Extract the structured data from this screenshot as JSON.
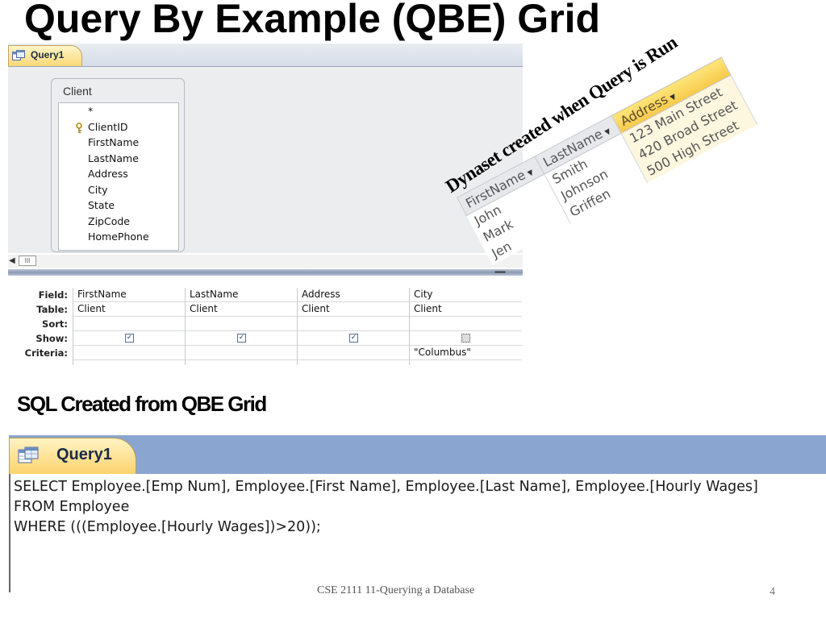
{
  "slide": {
    "title": "Query By Example (QBE) Grid",
    "sql_heading": "SQL Created from QBE Grid",
    "footer": "CSE 2111 11-Querying a Database",
    "number": "4"
  },
  "qbe": {
    "tab_label": "Query1",
    "table": {
      "name": "Client",
      "fields": [
        "*",
        "ClientID",
        "FirstName",
        "LastName",
        "Address",
        "City",
        "State",
        "ZipCode",
        "HomePhone"
      ]
    },
    "grid": {
      "row_headers": [
        "Field:",
        "Table:",
        "Sort:",
        "Show:",
        "Criteria:"
      ],
      "columns": [
        {
          "field": "FirstName",
          "table": "Client",
          "sort": "",
          "show": true,
          "criteria": ""
        },
        {
          "field": "LastName",
          "table": "Client",
          "sort": "",
          "show": true,
          "criteria": ""
        },
        {
          "field": "Address",
          "table": "Client",
          "sort": "",
          "show": true,
          "criteria": ""
        },
        {
          "field": "City",
          "table": "Client",
          "sort": "",
          "show": false,
          "criteria": "\"Columbus\""
        }
      ]
    }
  },
  "dynaset": {
    "caption": "Dynaset created when Query is Run",
    "headers": [
      "FirstName",
      "LastName",
      "Address"
    ],
    "rows": [
      [
        "John",
        "Smith",
        "123 Main Street"
      ],
      [
        "Mark",
        "Johnson",
        "420 Broad Street"
      ],
      [
        "Jen",
        "Griffen",
        "500 High Street"
      ]
    ]
  },
  "sql": {
    "tab_label": "Query1",
    "lines": [
      "SELECT Employee.[Emp Num], Employee.[First Name], Employee.[Last Name], Employee.[Hourly Wages]",
      "FROM Employee",
      "WHERE (((Employee.[Hourly Wages])>20));"
    ]
  }
}
